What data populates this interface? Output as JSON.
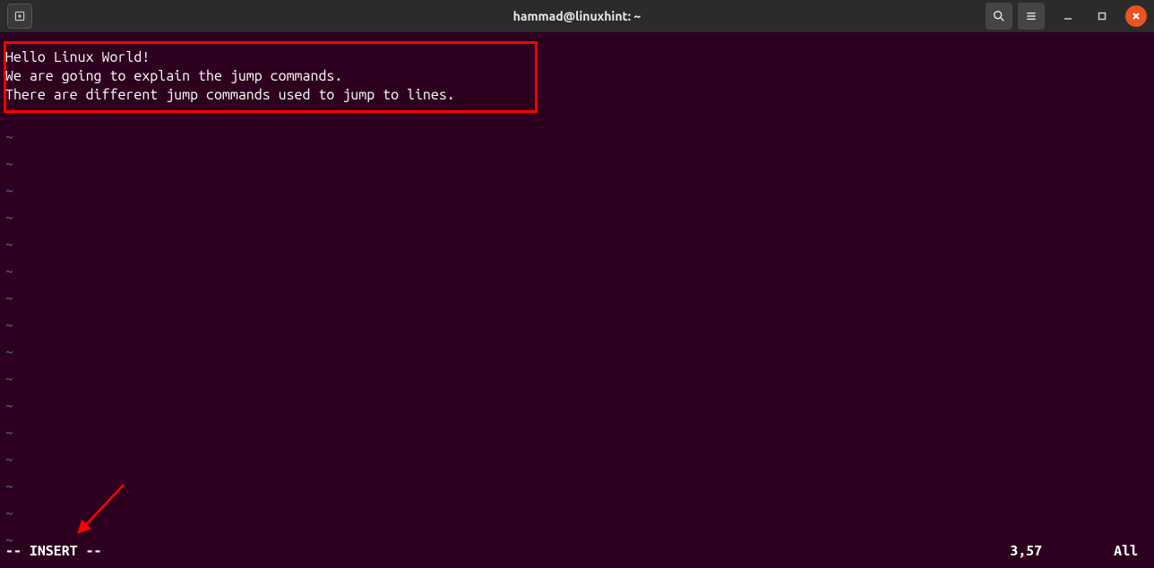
{
  "titlebar": {
    "title": "hammad@linuxhint: ~"
  },
  "editor": {
    "lines": [
      "Hello Linux World!",
      "We are going to explain the jump commands.",
      "There are different jump commands used to jump to lines."
    ],
    "empty_marker": "~"
  },
  "status": {
    "mode": "-- INSERT --",
    "position": "3,57",
    "scroll": "All"
  }
}
